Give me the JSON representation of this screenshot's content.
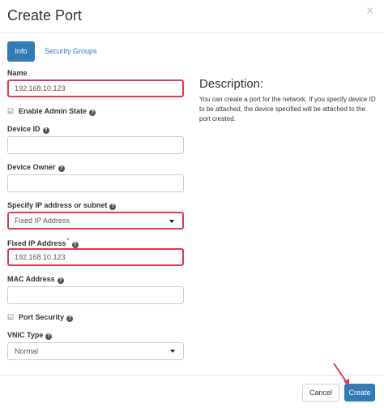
{
  "modal": {
    "title": "Create Port",
    "close_glyph": "×"
  },
  "tabs": [
    {
      "label": "Info",
      "active": true
    },
    {
      "label": "Security Groups",
      "active": false
    }
  ],
  "form": {
    "name": {
      "label": "Name",
      "value": "192.168.10.123"
    },
    "admin_state": {
      "label": "Enable Admin State",
      "checked": true
    },
    "device_id": {
      "label": "Device ID",
      "value": ""
    },
    "device_owner": {
      "label": "Device Owner",
      "value": ""
    },
    "ip_spec": {
      "label": "Specify IP address or subnet",
      "selected": "Fixed IP Address"
    },
    "fixed_ip": {
      "label": "Fixed IP Address",
      "required_mark": "*",
      "value": "192.168.10.123"
    },
    "mac": {
      "label": "MAC Address",
      "value": ""
    },
    "port_security": {
      "label": "Port Security",
      "checked": true
    },
    "vnic": {
      "label": "VNIC Type",
      "selected": "Normal"
    }
  },
  "description": {
    "title": "Description:",
    "text": "You can create a port for the network. If you specify device ID to be attached, the device specified will be attached to the port created."
  },
  "footer": {
    "cancel_label": "Cancel",
    "create_label": "Create"
  },
  "colors": {
    "primary": "#337ab7",
    "highlight": "#e03a4e"
  },
  "icons": {
    "help": "question-circle-icon",
    "check": "check-square-icon",
    "caret": "caret-down-icon",
    "close": "close-icon",
    "arrow": "annotation-arrow-icon"
  }
}
